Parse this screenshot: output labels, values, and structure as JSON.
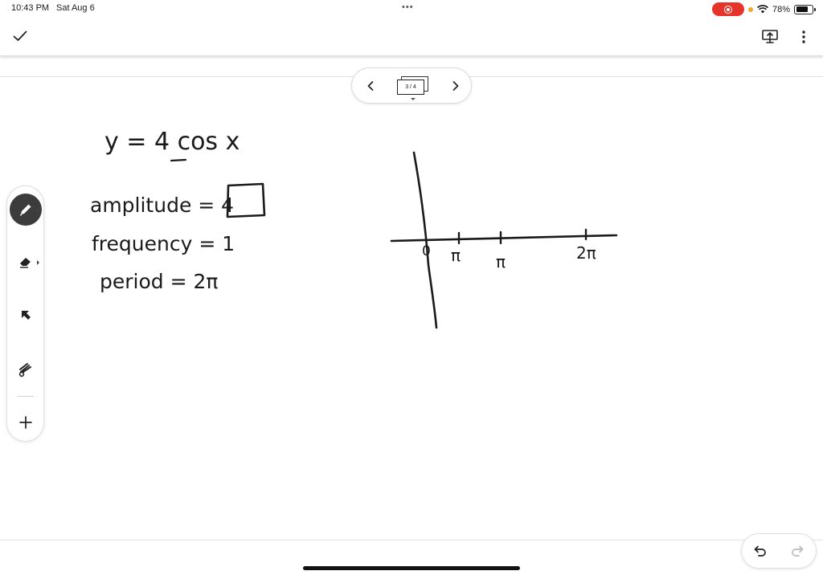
{
  "status_bar": {
    "time": "10:43 PM",
    "date": "Sat Aug 6",
    "battery_percent": "78%",
    "battery_level": 0.78,
    "recording_color": "#e5352b"
  },
  "toolbar": {
    "done_icon": "checkmark-icon",
    "present_icon": "present-screen-icon",
    "more_icon": "more-vertical-icon"
  },
  "page_navigator": {
    "page_label": "3 / 4"
  },
  "tools": [
    "pen",
    "eraser",
    "pointer",
    "laser",
    "add"
  ],
  "handwriting": {
    "equation": "y = 4 cos x",
    "amplitude": "amplitude = 4",
    "frequency": "frequency = 1",
    "period": "period = 2π",
    "graph_labels": {
      "origin": "0",
      "tick1": "π",
      "tick2": "π",
      "tick3": "2π"
    }
  }
}
